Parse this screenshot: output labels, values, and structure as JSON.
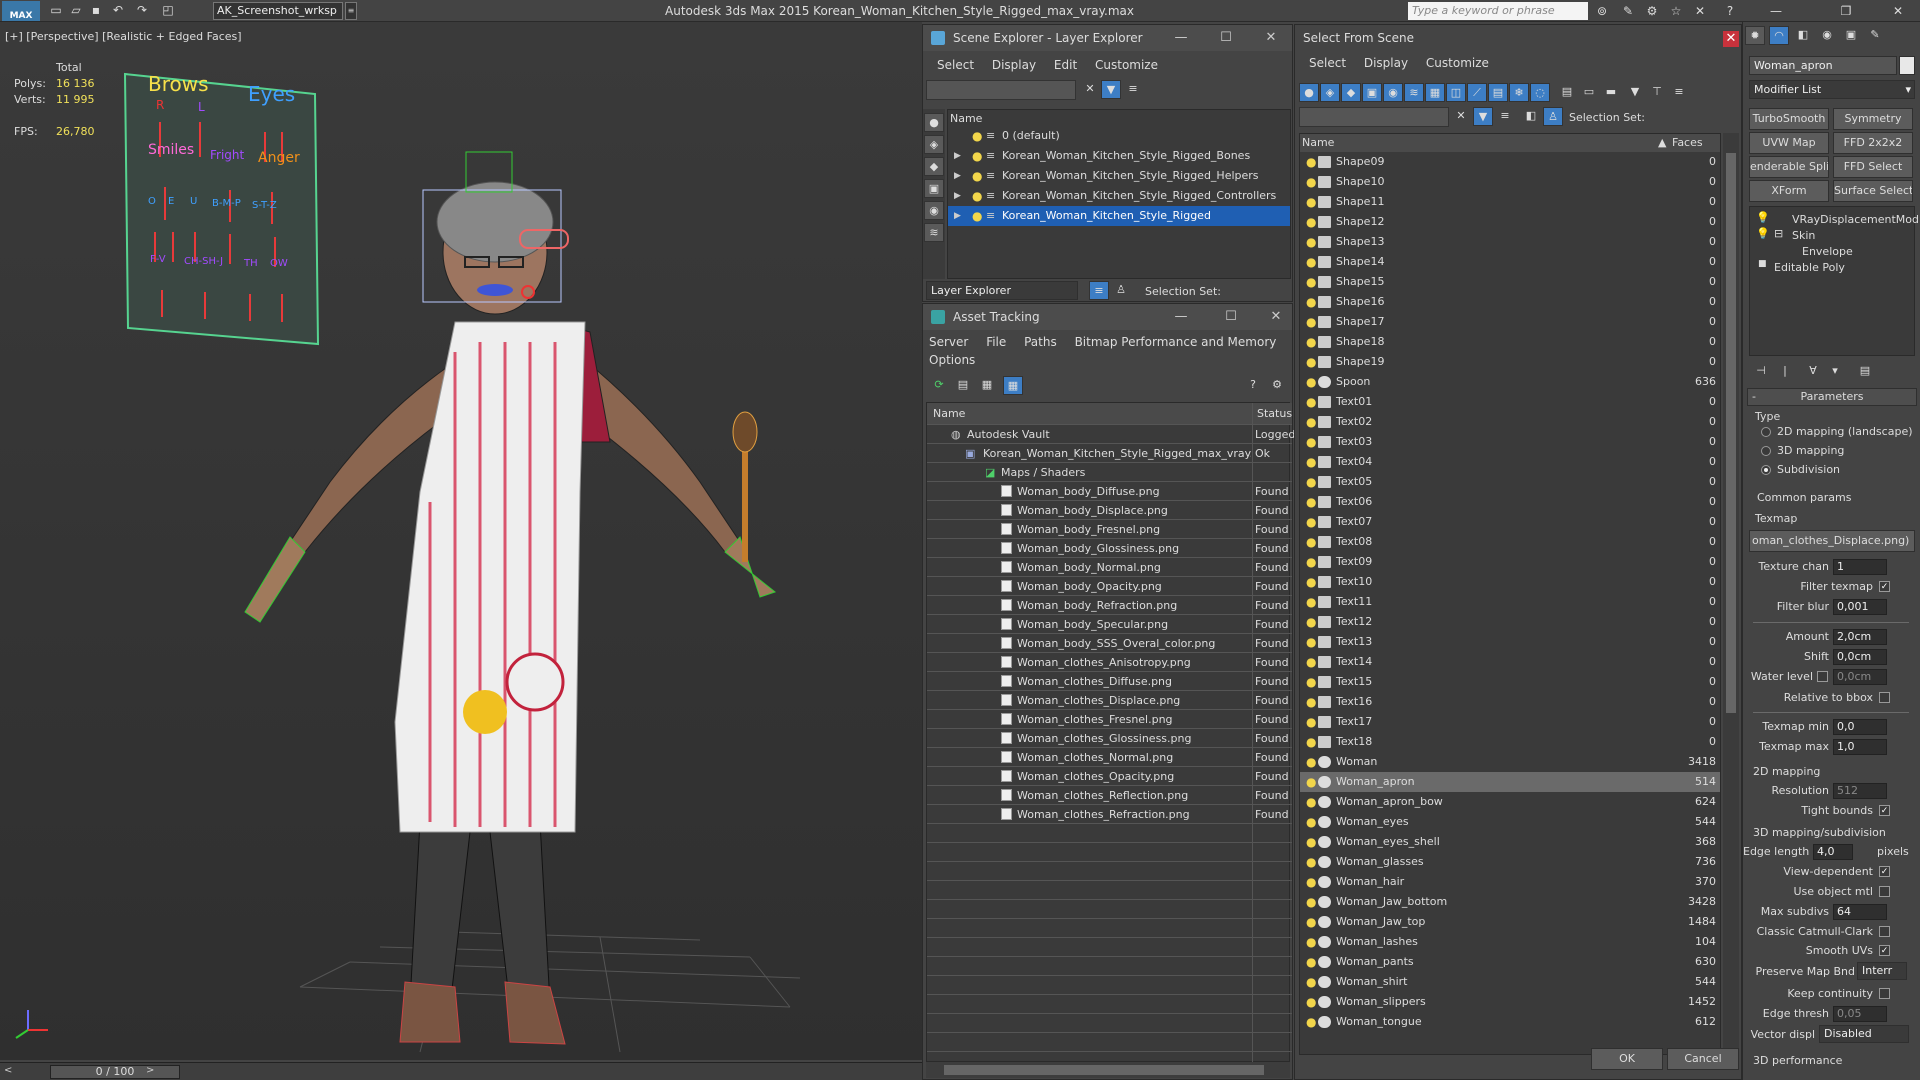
{
  "app": {
    "workspace": "AK_Screenshot_wrksp",
    "title": "Autodesk 3ds Max  2015    Korean_Woman_Kitchen_Style_Rigged_max_vray.max",
    "search_placeholder": "Type a keyword or phrase"
  },
  "viewport": {
    "label": "[+] [Perspective] [Realistic + Edged Faces]",
    "stats": {
      "total_label": "Total",
      "polys_label": "Polys:",
      "polys": "16 136",
      "verts_label": "Verts:",
      "verts": "11 995",
      "fps_label": "FPS:",
      "fps": "26,780"
    },
    "face_board": {
      "brows": "Brows",
      "eyes": "Eyes",
      "smiles": "Smiles",
      "anger": "Anger",
      "r": "R",
      "l": "L",
      "row2": [
        "O",
        "E",
        "U",
        "B-M-P",
        "S-T-Z"
      ],
      "row3": [
        "F-V",
        "CH-SH-J",
        "TH",
        "OW"
      ],
      "fright": "Fright"
    }
  },
  "timeline": {
    "value": "0 / 100"
  },
  "scene_explorer": {
    "title": "Scene Explorer - Layer Explorer",
    "menu": [
      "Select",
      "Display",
      "Edit",
      "Customize"
    ],
    "column_name": "Name",
    "layers": [
      "0 (default)",
      "Korean_Woman_Kitchen_Style_Rigged_Bones",
      "Korean_Woman_Kitchen_Style_Rigged_Helpers",
      "Korean_Woman_Kitchen_Style_Rigged_Controllers",
      "Korean_Woman_Kitchen_Style_Rigged"
    ],
    "footer_explorer": "Layer Explorer",
    "footer_selection": "Selection Set:"
  },
  "asset_tracking": {
    "title": "Asset Tracking",
    "menu": [
      "Server",
      "File",
      "Paths",
      "Bitmap Performance and Memory"
    ],
    "menu2": "Options",
    "col_name": "Name",
    "col_status": "Status",
    "vault": {
      "name": "Autodesk Vault",
      "status": "Logged"
    },
    "file": {
      "name": "Korean_Woman_Kitchen_Style_Rigged_max_vray...",
      "status": "Ok"
    },
    "maps_label": "Maps / Shaders",
    "maps": [
      {
        "name": "Woman_body_Diffuse.png",
        "status": "Found"
      },
      {
        "name": "Woman_body_Displace.png",
        "status": "Found"
      },
      {
        "name": "Woman_body_Fresnel.png",
        "status": "Found"
      },
      {
        "name": "Woman_body_Glossiness.png",
        "status": "Found"
      },
      {
        "name": "Woman_body_Normal.png",
        "status": "Found"
      },
      {
        "name": "Woman_body_Opacity.png",
        "status": "Found"
      },
      {
        "name": "Woman_body_Refraction.png",
        "status": "Found"
      },
      {
        "name": "Woman_body_Specular.png",
        "status": "Found"
      },
      {
        "name": "Woman_body_SSS_Overal_color.png",
        "status": "Found"
      },
      {
        "name": "Woman_clothes_Anisotropy.png",
        "status": "Found"
      },
      {
        "name": "Woman_clothes_Diffuse.png",
        "status": "Found"
      },
      {
        "name": "Woman_clothes_Displace.png",
        "status": "Found"
      },
      {
        "name": "Woman_clothes_Fresnel.png",
        "status": "Found"
      },
      {
        "name": "Woman_clothes_Glossiness.png",
        "status": "Found"
      },
      {
        "name": "Woman_clothes_Normal.png",
        "status": "Found"
      },
      {
        "name": "Woman_clothes_Opacity.png",
        "status": "Found"
      },
      {
        "name": "Woman_clothes_Reflection.png",
        "status": "Found"
      },
      {
        "name": "Woman_clothes_Refraction.png",
        "status": "Found"
      }
    ]
  },
  "select_from_scene": {
    "title": "Select From Scene",
    "menu": [
      "Select",
      "Display",
      "Customize"
    ],
    "selection_set": "Selection Set:",
    "col_name": "Name",
    "col_faces": "Faces",
    "rows": [
      {
        "name": "Shape09",
        "faces": "0",
        "kind": "shape"
      },
      {
        "name": "Shape10",
        "faces": "0",
        "kind": "shape"
      },
      {
        "name": "Shape11",
        "faces": "0",
        "kind": "shape"
      },
      {
        "name": "Shape12",
        "faces": "0",
        "kind": "shape"
      },
      {
        "name": "Shape13",
        "faces": "0",
        "kind": "shape"
      },
      {
        "name": "Shape14",
        "faces": "0",
        "kind": "shape"
      },
      {
        "name": "Shape15",
        "faces": "0",
        "kind": "shape"
      },
      {
        "name": "Shape16",
        "faces": "0",
        "kind": "shape"
      },
      {
        "name": "Shape17",
        "faces": "0",
        "kind": "shape"
      },
      {
        "name": "Shape18",
        "faces": "0",
        "kind": "shape"
      },
      {
        "name": "Shape19",
        "faces": "0",
        "kind": "shape"
      },
      {
        "name": "Spoon",
        "faces": "636",
        "kind": "mesh"
      },
      {
        "name": "Text01",
        "faces": "0",
        "kind": "shape"
      },
      {
        "name": "Text02",
        "faces": "0",
        "kind": "shape"
      },
      {
        "name": "Text03",
        "faces": "0",
        "kind": "shape"
      },
      {
        "name": "Text04",
        "faces": "0",
        "kind": "shape"
      },
      {
        "name": "Text05",
        "faces": "0",
        "kind": "shape"
      },
      {
        "name": "Text06",
        "faces": "0",
        "kind": "shape"
      },
      {
        "name": "Text07",
        "faces": "0",
        "kind": "shape"
      },
      {
        "name": "Text08",
        "faces": "0",
        "kind": "shape"
      },
      {
        "name": "Text09",
        "faces": "0",
        "kind": "shape"
      },
      {
        "name": "Text10",
        "faces": "0",
        "kind": "shape"
      },
      {
        "name": "Text11",
        "faces": "0",
        "kind": "shape"
      },
      {
        "name": "Text12",
        "faces": "0",
        "kind": "shape"
      },
      {
        "name": "Text13",
        "faces": "0",
        "kind": "shape"
      },
      {
        "name": "Text14",
        "faces": "0",
        "kind": "shape"
      },
      {
        "name": "Text15",
        "faces": "0",
        "kind": "shape"
      },
      {
        "name": "Text16",
        "faces": "0",
        "kind": "shape"
      },
      {
        "name": "Text17",
        "faces": "0",
        "kind": "shape"
      },
      {
        "name": "Text18",
        "faces": "0",
        "kind": "shape"
      },
      {
        "name": "Woman",
        "faces": "3418",
        "kind": "mesh"
      },
      {
        "name": "Woman_apron",
        "faces": "514",
        "kind": "mesh",
        "selected": true
      },
      {
        "name": "Woman_apron_bow",
        "faces": "624",
        "kind": "mesh"
      },
      {
        "name": "Woman_eyes",
        "faces": "544",
        "kind": "mesh"
      },
      {
        "name": "Woman_eyes_shell",
        "faces": "368",
        "kind": "mesh"
      },
      {
        "name": "Woman_glasses",
        "faces": "736",
        "kind": "mesh"
      },
      {
        "name": "Woman_hair",
        "faces": "370",
        "kind": "mesh"
      },
      {
        "name": "Woman_Jaw_bottom",
        "faces": "3428",
        "kind": "mesh"
      },
      {
        "name": "Woman_Jaw_top",
        "faces": "1484",
        "kind": "mesh"
      },
      {
        "name": "Woman_lashes",
        "faces": "104",
        "kind": "mesh"
      },
      {
        "name": "Woman_pants",
        "faces": "630",
        "kind": "mesh"
      },
      {
        "name": "Woman_shirt",
        "faces": "544",
        "kind": "mesh"
      },
      {
        "name": "Woman_slippers",
        "faces": "1452",
        "kind": "mesh"
      },
      {
        "name": "Woman_tongue",
        "faces": "612",
        "kind": "mesh"
      }
    ],
    "ok": "OK",
    "cancel": "Cancel"
  },
  "command_panel": {
    "object_name": "Woman_apron",
    "modifier_list": "Modifier List",
    "buttons": [
      "TurboSmooth",
      "Symmetry",
      "UVW Map",
      "FFD 2x2x2",
      "enderable Splin",
      "FFD Select",
      "XForm",
      "Surface Select"
    ],
    "stack": [
      "VRayDisplacementMod",
      "Skin",
      "Envelope",
      "Editable Poly"
    ],
    "rollout": "Parameters",
    "type_label": "Type",
    "type_options": [
      "2D mapping (landscape)",
      "3D mapping",
      "Subdivision"
    ],
    "common_params": "Common params",
    "texmap_label": "Texmap",
    "texmap_value": "oman_clothes_Displace.png)",
    "texture_chan_label": "Texture chan",
    "texture_chan": "1",
    "filter_texmap_label": "Filter texmap",
    "filter_blur_label": "Filter blur",
    "filter_blur": "0,001",
    "amount_label": "Amount",
    "amount": "2,0cm",
    "shift_label": "Shift",
    "shift": "0,0cm",
    "water_level_label": "Water level",
    "water_level": "0,0cm",
    "relative_bbox_label": "Relative to bbox",
    "texmap_min_label": "Texmap min",
    "texmap_min": "0,0",
    "texmap_max_label": "Texmap max",
    "texmap_max": "1,0",
    "mapping2d_label": "2D mapping",
    "resolution_label": "Resolution",
    "resolution": "512",
    "tight_bounds_label": "Tight bounds",
    "mapping3d_label": "3D mapping/subdivision",
    "edge_length_label": "Edge length",
    "edge_length": "4,0",
    "pixels_label": "pixels",
    "view_dependent_label": "View-dependent",
    "use_object_mtl_label": "Use object mtl",
    "max_subdivs_label": "Max subdivs",
    "max_subdivs": "64",
    "catmull_label": "Classic Catmull-Clark",
    "smooth_uvs_label": "Smooth UVs",
    "preserve_map_label": "Preserve Map Bnd",
    "preserve_map_value": "Interr",
    "keep_continuity_label": "Keep continuity",
    "edge_thresh_label": "Edge thresh",
    "edge_thresh": "0,05",
    "vector_displ_label": "Vector displ",
    "vector_displ_value": "Disabled",
    "perf_label": "3D performance"
  }
}
